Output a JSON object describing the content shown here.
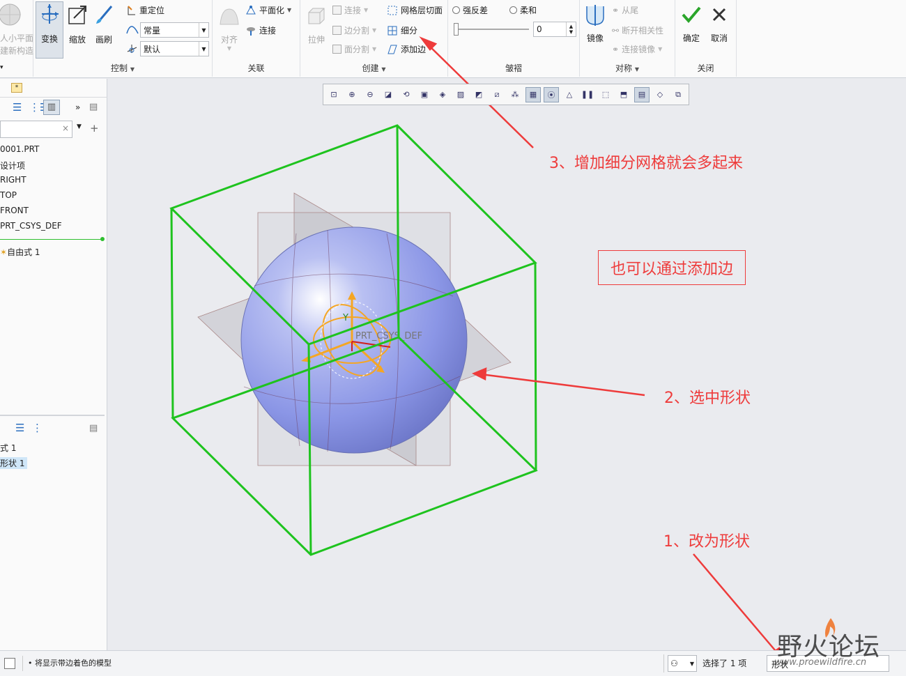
{
  "ribbon": {
    "partial_left_lines": [
      "人小平面",
      "建新构造"
    ],
    "control": {
      "transform": "变换",
      "scale": "缩放",
      "brush": "画刷",
      "reposition": "重定位",
      "select_1": "常量",
      "select_2": "默认",
      "group_label": "控制"
    },
    "relate": {
      "align": "对齐",
      "flatten": "平面化",
      "connect": "连接",
      "group_label": "关联"
    },
    "create": {
      "extrude": "拉伸",
      "connect": "连接",
      "edge_split": "边分割",
      "face_split": "面分割",
      "mesh_section": "网格层切面",
      "subdivide": "细分",
      "add_edge": "添加边",
      "group_label": "创建"
    },
    "crease": {
      "strong_crease": "强反差",
      "soft": "柔和",
      "value": "0",
      "slider_fraction": 0.0,
      "group_label": "皱褶"
    },
    "symmetry": {
      "mirror": "镜像",
      "from_tail": "从尾",
      "break_related": "断开相关性",
      "connect_mirror": "连接镜像",
      "group_label": "对称"
    },
    "close": {
      "ok": "确定",
      "cancel": "取消",
      "group_label": "关闭"
    }
  },
  "model_tree": {
    "items": [
      "0001.PRT",
      "设计项",
      "RIGHT",
      "TOP",
      "FRONT",
      "PRT_CSYS_DEF"
    ],
    "insert_item": "自由式 1"
  },
  "lower_tree": {
    "items": [
      "式 1",
      "形状 1"
    ]
  },
  "canvas": {
    "csys_label": "PRT_CSYS_DEF",
    "axis_label": "Y"
  },
  "annotations": {
    "a1": "1、改为形状",
    "a2": "2、选中形状",
    "a3": "3、增加细分网格就会多起来",
    "box": "也可以通过添加边"
  },
  "status": {
    "message": "将显示带边着色的模型",
    "selected": "选择了 1 项",
    "filter_value": "形状"
  },
  "watermark": {
    "cn": "野火论坛",
    "url": "www.proewildfire.cn"
  },
  "colors": {
    "cage_green": "#1ec31e",
    "sphere_blue": "#8b96e6",
    "annotation_red": "#ee3b3b",
    "accent_orange": "#f5a623"
  },
  "icons": [
    "transform-icon",
    "scale-icon",
    "brush-icon",
    "checkmark-icon",
    "close-x-icon",
    "mirror-icon",
    "extrude-icon"
  ]
}
